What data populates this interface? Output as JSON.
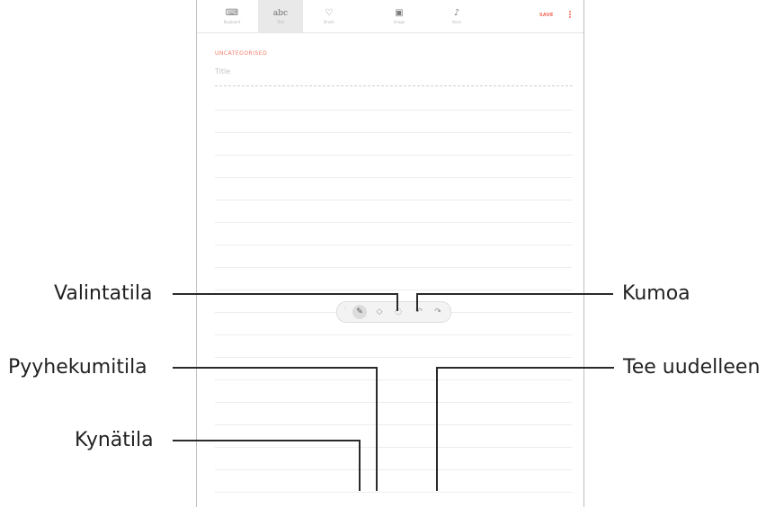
{
  "toolbar": {
    "tabs": [
      {
        "label": "Keyboard",
        "icon": "keyboard-icon",
        "glyph": "⌨",
        "active": false
      },
      {
        "label": "Text",
        "icon": "text-icon",
        "glyph": "abc",
        "active": true
      },
      {
        "label": "Brush",
        "icon": "brush-icon",
        "glyph": "♡",
        "active": false
      },
      {
        "label": "Image",
        "icon": "image-icon",
        "glyph": "▣",
        "active": false
      },
      {
        "label": "Voice",
        "icon": "mic-icon",
        "glyph": "♪",
        "active": false
      }
    ],
    "save_label": "SAVE",
    "more_icon": "more-vertical-icon"
  },
  "note": {
    "category": "UNCATEGORISED",
    "title_placeholder": "Title"
  },
  "pen_toolbar": {
    "tools": [
      {
        "name": "pen-mode",
        "icon": "pen-icon",
        "glyph": "✎",
        "active": true
      },
      {
        "name": "eraser-mode",
        "icon": "eraser-icon",
        "glyph": "◇",
        "active": false
      },
      {
        "name": "selection-mode",
        "icon": "selection-icon",
        "glyph": "◌",
        "active": false
      },
      {
        "name": "undo",
        "icon": "undo-icon",
        "glyph": "↶",
        "active": false
      },
      {
        "name": "redo",
        "icon": "redo-icon",
        "glyph": "↷",
        "active": false
      }
    ]
  },
  "callouts": {
    "selection": "Valintatila",
    "eraser": "Pyyhekumitila",
    "pen": "Kynätila",
    "undo": "Kumoa",
    "redo": "Tee uudelleen"
  },
  "colors": {
    "accent": "#f46a55",
    "callout_line": "#2a2a2a"
  }
}
